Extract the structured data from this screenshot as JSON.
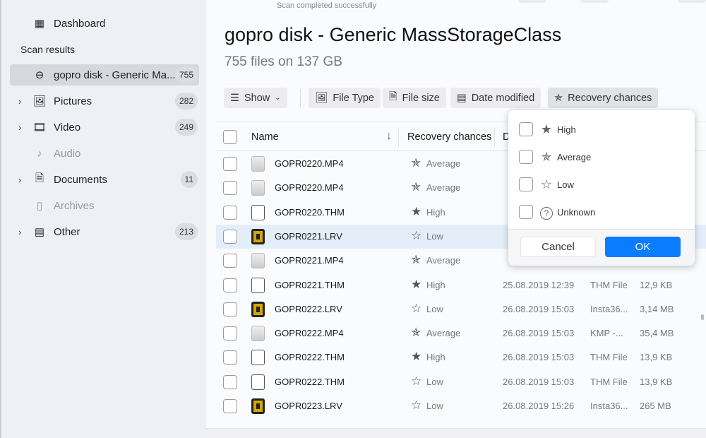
{
  "sidebar": {
    "dashboard": {
      "label": "Dashboard",
      "icon": "grid-icon"
    },
    "section_title": "Scan results",
    "items": [
      {
        "label": "gopro disk - Generic Ma...",
        "count": "755",
        "icon": "drive-icon",
        "selected": true,
        "expandable": false,
        "disabled": false
      },
      {
        "label": "Pictures",
        "count": "282",
        "icon": "image-icon",
        "expandable": true,
        "disabled": false
      },
      {
        "label": "Video",
        "count": "249",
        "icon": "film-icon",
        "expandable": true,
        "disabled": false
      },
      {
        "label": "Audio",
        "count": "",
        "icon": "music-icon",
        "expandable": false,
        "disabled": true
      },
      {
        "label": "Documents",
        "count": "11",
        "icon": "document-icon",
        "expandable": true,
        "disabled": false
      },
      {
        "label": "Archives",
        "count": "",
        "icon": "archive-icon",
        "expandable": false,
        "disabled": true
      },
      {
        "label": "Other",
        "count": "213",
        "icon": "file-icon",
        "expandable": true,
        "disabled": false
      }
    ]
  },
  "header": {
    "status": "Scan completed successfully",
    "title": "gopro disk - Generic MassStorageClass",
    "subtitle": "755 files on 137 GB"
  },
  "filters": {
    "show": "Show",
    "file_type": "File Type",
    "file_size": "File size",
    "date_modified": "Date modified",
    "recovery_chances": "Recovery chances"
  },
  "table": {
    "columns": {
      "name": "Name",
      "recovery": "Recovery chances",
      "date": "D"
    },
    "rows": [
      {
        "name": "GOPR0220.MP4",
        "kind": "mp4",
        "recovery": "Average",
        "date": "",
        "type": "",
        "size": ""
      },
      {
        "name": "GOPR0220.MP4",
        "kind": "mp4",
        "recovery": "Average",
        "date": "",
        "type": "",
        "size": ""
      },
      {
        "name": "GOPR0220.THM",
        "kind": "thm",
        "recovery": "High",
        "date": "",
        "type": "",
        "size": ""
      },
      {
        "name": "GOPR0221.LRV",
        "kind": "lrv",
        "recovery": "Low",
        "date": "",
        "type": "",
        "size": "",
        "selected": true
      },
      {
        "name": "GOPR0221.MP4",
        "kind": "mp4",
        "recovery": "Average",
        "date": "",
        "type": "",
        "size": ""
      },
      {
        "name": "GOPR0221.THM",
        "kind": "thm",
        "recovery": "High",
        "date": "25.08.2019 12:39",
        "type": "THM File",
        "size": "12,9 KB"
      },
      {
        "name": "GOPR0222.LRV",
        "kind": "lrv",
        "recovery": "Low",
        "date": "26.08.2019 15:03",
        "type": "Insta36...",
        "size": "3,14 MB"
      },
      {
        "name": "GOPR0222.MP4",
        "kind": "mp4",
        "recovery": "Average",
        "date": "26.08.2019 15:03",
        "type": "KMP -...",
        "size": "35,4 MB"
      },
      {
        "name": "GOPR0222.THM",
        "kind": "thm",
        "recovery": "High",
        "date": "26.08.2019 15:03",
        "type": "THM File",
        "size": "13,9 KB"
      },
      {
        "name": "GOPR0222.THM",
        "kind": "thm",
        "recovery": "Low",
        "date": "26.08.2019 15:03",
        "type": "THM File",
        "size": "13,9 KB"
      },
      {
        "name": "GOPR0223.LRV",
        "kind": "lrv",
        "recovery": "Low",
        "date": "26.08.2019 15:26",
        "type": "Insta36...",
        "size": "265 MB"
      }
    ]
  },
  "popup": {
    "options": [
      {
        "label": "High",
        "icon": "star-full-icon",
        "checked": false
      },
      {
        "label": "Average",
        "icon": "star-half-icon",
        "checked": false
      },
      {
        "label": "Low",
        "icon": "star-empty-icon",
        "checked": false
      },
      {
        "label": "Unknown",
        "icon": "question-circle-icon",
        "checked": false
      }
    ],
    "cancel": "Cancel",
    "ok": "OK"
  },
  "colors": {
    "accent": "#0a7cff",
    "selected_row": "#e4eef9",
    "sidebar_bg": "#eef0f5"
  }
}
